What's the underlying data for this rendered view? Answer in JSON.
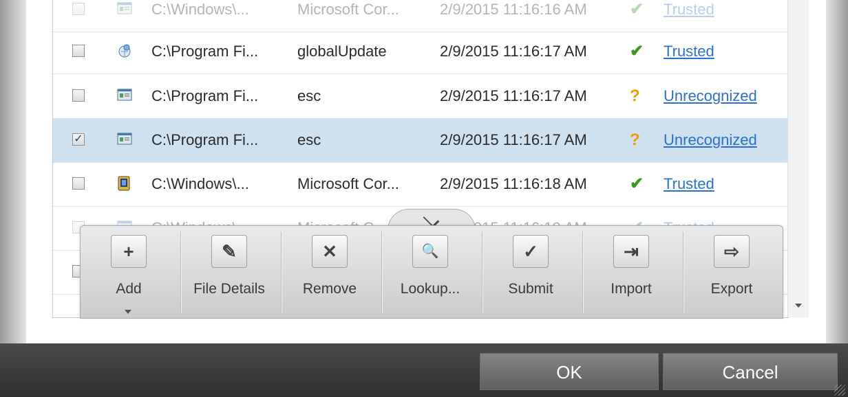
{
  "files": {
    "rows": [
      {
        "checked": false,
        "path": "C:\\Windows\\...",
        "company": "Microsoft Cor...",
        "date": "2/9/2015 11:16:16 AM",
        "status": "check",
        "rating": "Trusted",
        "icon": "exe-window-icon"
      },
      {
        "checked": false,
        "path": "C:\\Program Fi...",
        "company": "globalUpdate",
        "date": "2/9/2015 11:16:17 AM",
        "status": "check",
        "rating": "Trusted",
        "icon": "globe-update-icon"
      },
      {
        "checked": false,
        "path": "C:\\Program Fi...",
        "company": "esc",
        "date": "2/9/2015 11:16:17 AM",
        "status": "question",
        "rating": "Unrecognized",
        "icon": "exe-window-icon"
      },
      {
        "checked": true,
        "path": "C:\\Program Fi...",
        "company": "esc",
        "date": "2/9/2015 11:16:17 AM",
        "status": "question",
        "rating": "Unrecognized",
        "icon": "exe-window-icon"
      },
      {
        "checked": false,
        "path": "C:\\Windows\\...",
        "company": "Microsoft Cor...",
        "date": "2/9/2015 11:16:18 AM",
        "status": "check",
        "rating": "Trusted",
        "icon": "system-file-icon"
      },
      {
        "checked": false,
        "path": "C:\\Windows\\...",
        "company": "Microsoft C...",
        "date": "2/9/2015 11:16:19 AM",
        "status": "check",
        "rating": "Trusted",
        "icon": "exe-window-icon"
      },
      {
        "checked": false,
        "path": "",
        "company": "",
        "date": "",
        "status": "",
        "rating": "",
        "icon": ""
      }
    ]
  },
  "toolbar": {
    "buttons": [
      {
        "label": "Add",
        "icon": "plus-icon",
        "glyph": "+"
      },
      {
        "label": "File Details",
        "icon": "pen-icon",
        "glyph": "✎"
      },
      {
        "label": "Remove",
        "icon": "close-icon",
        "glyph": "✕"
      },
      {
        "label": "Lookup...",
        "icon": "search-icon",
        "glyph": "🔍"
      },
      {
        "label": "Submit",
        "icon": "checkmark-icon",
        "glyph": "✓"
      },
      {
        "label": "Import",
        "icon": "import-icon",
        "glyph": "⇥"
      },
      {
        "label": "Export",
        "icon": "export-icon",
        "glyph": "⇨"
      }
    ]
  },
  "footer": {
    "ok_label": "OK",
    "cancel_label": "Cancel"
  },
  "colors": {
    "trusted_check": "#3b9a1e",
    "unrecognized_mark": "#f29a00",
    "link": "#2a6fd6",
    "selected_row": "#cfe0ee"
  }
}
